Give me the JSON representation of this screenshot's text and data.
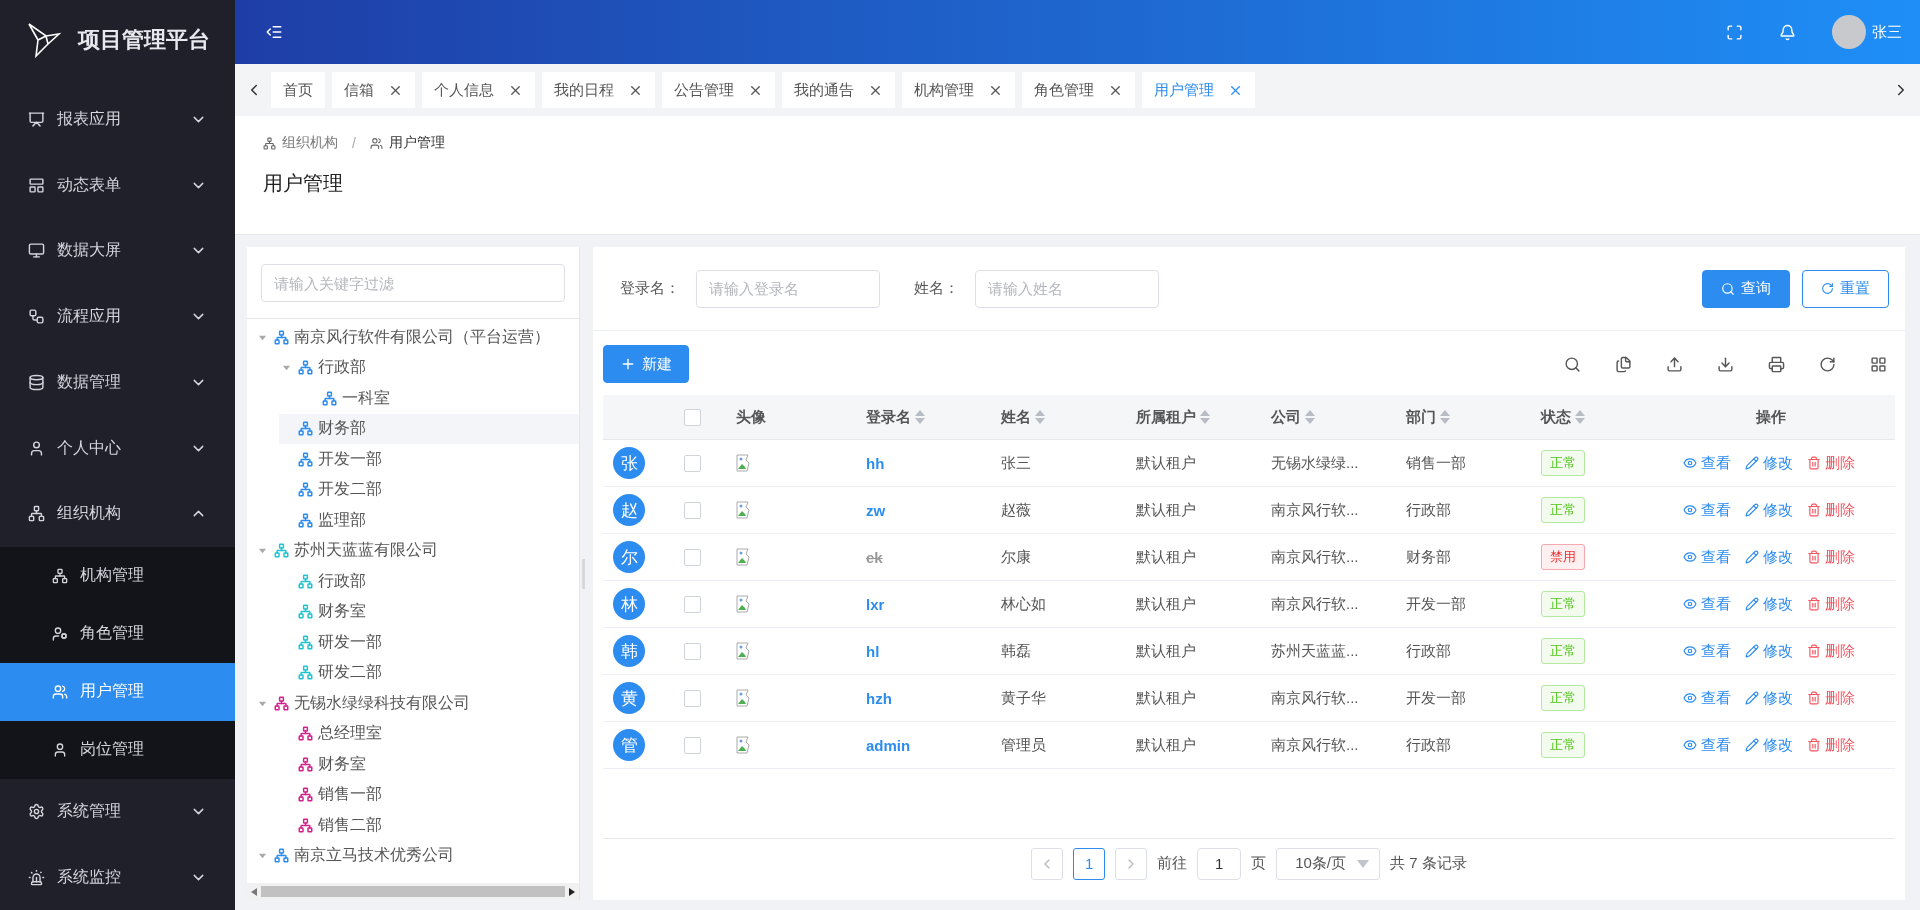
{
  "app": {
    "title": "项目管理平台"
  },
  "sidebar": {
    "items": [
      {
        "label": "报表应用",
        "expanded": false
      },
      {
        "label": "动态表单",
        "expanded": false
      },
      {
        "label": "数据大屏",
        "expanded": false
      },
      {
        "label": "流程应用",
        "expanded": false
      },
      {
        "label": "数据管理",
        "expanded": false
      },
      {
        "label": "个人中心",
        "expanded": false
      },
      {
        "label": "组织机构",
        "expanded": true,
        "children": [
          {
            "label": "机构管理",
            "selected": false
          },
          {
            "label": "角色管理",
            "selected": false
          },
          {
            "label": "用户管理",
            "selected": true
          },
          {
            "label": "岗位管理",
            "selected": false
          }
        ]
      },
      {
        "label": "系统管理",
        "expanded": false
      },
      {
        "label": "系统监控",
        "expanded": false
      }
    ]
  },
  "header": {
    "user": "张三"
  },
  "tabs": [
    {
      "label": "首页",
      "closable": false,
      "selected": false
    },
    {
      "label": "信箱",
      "closable": true,
      "selected": false
    },
    {
      "label": "个人信息",
      "closable": true,
      "selected": false
    },
    {
      "label": "我的日程",
      "closable": true,
      "selected": false
    },
    {
      "label": "公告管理",
      "closable": true,
      "selected": false
    },
    {
      "label": "我的通告",
      "closable": true,
      "selected": false
    },
    {
      "label": "机构管理",
      "closable": true,
      "selected": false
    },
    {
      "label": "角色管理",
      "closable": true,
      "selected": false
    },
    {
      "label": "用户管理",
      "closable": true,
      "selected": true
    }
  ],
  "breadcrumb": {
    "separator": "/",
    "items": [
      "组织机构",
      "用户管理"
    ]
  },
  "page_title": "用户管理",
  "tree": {
    "placeholder": "请输入关键字过滤",
    "nodes": [
      {
        "label": "南京风行软件有限公司（平台运营）",
        "color": "#2b8cf0",
        "expanded": true,
        "selected": false,
        "children": [
          {
            "label": "行政部",
            "expanded": true,
            "selected": false,
            "children": [
              {
                "label": "一科室",
                "selected": false
              }
            ]
          },
          {
            "label": "财务部",
            "selected": true
          },
          {
            "label": "开发一部",
            "selected": false
          },
          {
            "label": "开发二部",
            "selected": false
          },
          {
            "label": "监理部",
            "selected": false
          }
        ]
      },
      {
        "label": "苏州天蓝蓝有限公司",
        "color": "#1fc4d4",
        "expanded": true,
        "selected": false,
        "children": [
          {
            "label": "行政部",
            "selected": false
          },
          {
            "label": "财务室",
            "selected": false
          },
          {
            "label": "研发一部",
            "selected": false
          },
          {
            "label": "研发二部",
            "selected": false
          }
        ]
      },
      {
        "label": "无锡水绿绿科技有限公司",
        "color": "#d4208c",
        "expanded": true,
        "selected": false,
        "children": [
          {
            "label": "总经理室",
            "selected": false
          },
          {
            "label": "财务室",
            "selected": false
          },
          {
            "label": "销售一部",
            "selected": false
          },
          {
            "label": "销售二部",
            "selected": false
          }
        ]
      },
      {
        "label": "南京立马技术优秀公司",
        "color": "#2b8cf0",
        "expanded": true,
        "selected": false
      }
    ]
  },
  "search": {
    "fields": [
      {
        "label": "登录名：",
        "placeholder": "请输入登录名"
      },
      {
        "label": "姓名：",
        "placeholder": "请输入姓名"
      }
    ],
    "buttons": [
      {
        "label": "查询",
        "kind": "primary"
      },
      {
        "label": "重置",
        "kind": "plain"
      }
    ]
  },
  "toolbar": {
    "new_button": "新建"
  },
  "table": {
    "header_checked": false,
    "columns": [
      {
        "label": "头像",
        "sortable": false
      },
      {
        "label": "登录名",
        "sortable": true
      },
      {
        "label": "姓名",
        "sortable": true
      },
      {
        "label": "所属租户",
        "sortable": true
      },
      {
        "label": "公司",
        "sortable": true
      },
      {
        "label": "部门",
        "sortable": true
      },
      {
        "label": "状态",
        "sortable": true
      },
      {
        "label": "操作",
        "sortable": false
      }
    ],
    "rows": [
      {
        "avatar": "张",
        "checked": false,
        "login": "hh",
        "name": "张三",
        "tenant": "默认租户",
        "company": "无锡水绿绿...",
        "dept": "销售一部",
        "status": "正常",
        "disabled": false,
        "actions": [
          "查看",
          "修改",
          "删除"
        ]
      },
      {
        "avatar": "赵",
        "checked": false,
        "login": "zw",
        "name": "赵薇",
        "tenant": "默认租户",
        "company": "南京风行软...",
        "dept": "行政部",
        "status": "正常",
        "disabled": false,
        "actions": [
          "查看",
          "修改",
          "删除"
        ]
      },
      {
        "avatar": "尔",
        "checked": false,
        "login": "ek",
        "name": "尔康",
        "tenant": "默认租户",
        "company": "南京风行软...",
        "dept": "财务部",
        "status": "禁用",
        "disabled": true,
        "actions": [
          "查看",
          "修改",
          "删除"
        ]
      },
      {
        "avatar": "林",
        "checked": false,
        "login": "lxr",
        "name": "林心如",
        "tenant": "默认租户",
        "company": "南京风行软...",
        "dept": "开发一部",
        "status": "正常",
        "disabled": false,
        "actions": [
          "查看",
          "修改",
          "删除"
        ]
      },
      {
        "avatar": "韩",
        "checked": false,
        "login": "hl",
        "name": "韩磊",
        "tenant": "默认租户",
        "company": "苏州天蓝蓝...",
        "dept": "行政部",
        "status": "正常",
        "disabled": false,
        "actions": [
          "查看",
          "修改",
          "删除"
        ]
      },
      {
        "avatar": "黄",
        "checked": false,
        "login": "hzh",
        "name": "黄子华",
        "tenant": "默认租户",
        "company": "南京风行软...",
        "dept": "开发一部",
        "status": "正常",
        "disabled": false,
        "actions": [
          "查看",
          "修改",
          "删除"
        ]
      },
      {
        "avatar": "管",
        "checked": false,
        "login": "admin",
        "name": "管理员",
        "tenant": "默认租户",
        "company": "南京风行软...",
        "dept": "行政部",
        "status": "正常",
        "disabled": false,
        "actions": [
          "查看",
          "修改",
          "删除"
        ]
      }
    ]
  },
  "pagination": {
    "page": "1",
    "goto_label": "前往",
    "goto_value": "1",
    "page_unit": "页",
    "page_size": "10条/页",
    "total": "共 7 条记录"
  }
}
